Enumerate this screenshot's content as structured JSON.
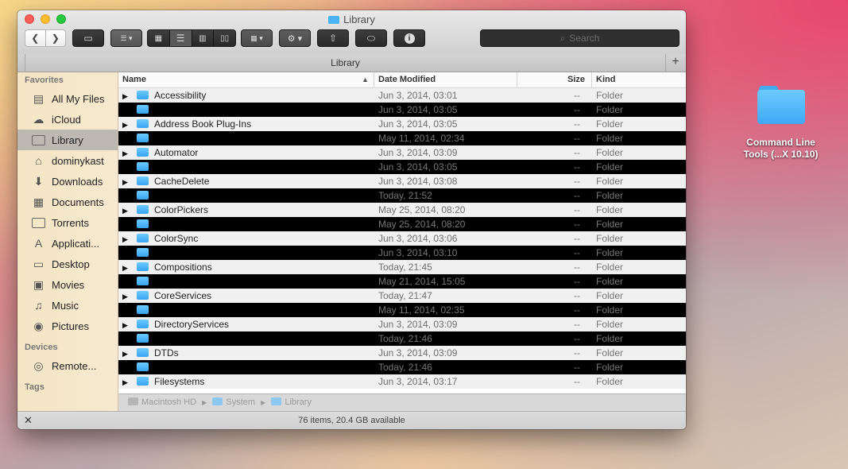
{
  "window": {
    "title": "Library"
  },
  "toolbar": {
    "search_placeholder": "Search"
  },
  "tabbar": {
    "tab_label": "Library",
    "add_tab": "+"
  },
  "sidebar": {
    "favorites_heading": "Favorites",
    "favorites": [
      {
        "label": "All My Files",
        "icon": "all-files-icon",
        "glyph": "▤"
      },
      {
        "label": "iCloud",
        "icon": "cloud-icon",
        "glyph": "☁"
      },
      {
        "label": "Library",
        "icon": "folder-icon",
        "glyph": "folder"
      },
      {
        "label": "dominykast",
        "icon": "home-icon",
        "glyph": "⌂"
      },
      {
        "label": "Downloads",
        "icon": "download-icon",
        "glyph": "⬇"
      },
      {
        "label": "Documents",
        "icon": "documents-icon",
        "glyph": "▦"
      },
      {
        "label": "Torrents",
        "icon": "folder-icon",
        "glyph": "folder"
      },
      {
        "label": "Applicati...",
        "icon": "applications-icon",
        "glyph": "A"
      },
      {
        "label": "Desktop",
        "icon": "desktop-icon",
        "glyph": "▭"
      },
      {
        "label": "Movies",
        "icon": "film-icon",
        "glyph": "▣"
      },
      {
        "label": "Music",
        "icon": "music-icon",
        "glyph": "♫"
      },
      {
        "label": "Pictures",
        "icon": "camera-icon",
        "glyph": "◉"
      }
    ],
    "devices_heading": "Devices",
    "devices": [
      {
        "label": "Remote...",
        "icon": "disc-icon",
        "glyph": "◎"
      }
    ],
    "tags_heading": "Tags"
  },
  "columns": {
    "name": "Name",
    "date": "Date Modified",
    "size": "Size",
    "kind": "Kind",
    "sort_arrow": "▲"
  },
  "rows": [
    {
      "name": "Accessibility",
      "date": "Jun 3, 2014, 03:01",
      "size": "--",
      "kind": "Folder"
    },
    {
      "name": "",
      "date": "Jun 3, 2014, 03:05",
      "size": "--",
      "kind": "Folder"
    },
    {
      "name": "Address Book Plug-Ins",
      "date": "Jun 3, 2014, 03:05",
      "size": "--",
      "kind": "Folder"
    },
    {
      "name": "",
      "date": "May 11, 2014, 02:34",
      "size": "--",
      "kind": "Folder"
    },
    {
      "name": "Automator",
      "date": "Jun 3, 2014, 03:09",
      "size": "--",
      "kind": "Folder"
    },
    {
      "name": "",
      "date": "Jun 3, 2014, 03:05",
      "size": "--",
      "kind": "Folder"
    },
    {
      "name": "CacheDelete",
      "date": "Jun 3, 2014, 03:08",
      "size": "--",
      "kind": "Folder"
    },
    {
      "name": "",
      "date": "Today, 21:52",
      "size": "--",
      "kind": "Folder"
    },
    {
      "name": "ColorPickers",
      "date": "May 25, 2014, 08:20",
      "size": "--",
      "kind": "Folder"
    },
    {
      "name": "",
      "date": "May 25, 2014, 08:20",
      "size": "--",
      "kind": "Folder"
    },
    {
      "name": "ColorSync",
      "date": "Jun 3, 2014, 03:06",
      "size": "--",
      "kind": "Folder"
    },
    {
      "name": "",
      "date": "Jun 3, 2014, 03:10",
      "size": "--",
      "kind": "Folder"
    },
    {
      "name": "Compositions",
      "date": "Today, 21:45",
      "size": "--",
      "kind": "Folder"
    },
    {
      "name": "",
      "date": "May 21, 2014, 15:05",
      "size": "--",
      "kind": "Folder"
    },
    {
      "name": "CoreServices",
      "date": "Today, 21:47",
      "size": "--",
      "kind": "Folder"
    },
    {
      "name": "",
      "date": "May 11, 2014, 02:35",
      "size": "--",
      "kind": "Folder"
    },
    {
      "name": "DirectoryServices",
      "date": "Jun 3, 2014, 03:09",
      "size": "--",
      "kind": "Folder"
    },
    {
      "name": "",
      "date": "Today, 21:46",
      "size": "--",
      "kind": "Folder"
    },
    {
      "name": "DTDs",
      "date": "Jun 3, 2014, 03:09",
      "size": "--",
      "kind": "Folder"
    },
    {
      "name": "",
      "date": "Today, 21:46",
      "size": "--",
      "kind": "Folder"
    },
    {
      "name": "Filesystems",
      "date": "Jun 3, 2014, 03:17",
      "size": "--",
      "kind": "Folder"
    }
  ],
  "pathbar": {
    "items": [
      "Macintosh HD",
      "System",
      "Library"
    ]
  },
  "status": {
    "text": "76 items, 20.4 GB available"
  },
  "desktop": {
    "icon_label_line1": "Command Line",
    "icon_label_line2": "Tools (...X 10.10)"
  },
  "colors": {
    "accent_folder": "#3fa9f5",
    "sidebar_bg": "#f4e5c4",
    "selection": "#bdb9b2"
  }
}
